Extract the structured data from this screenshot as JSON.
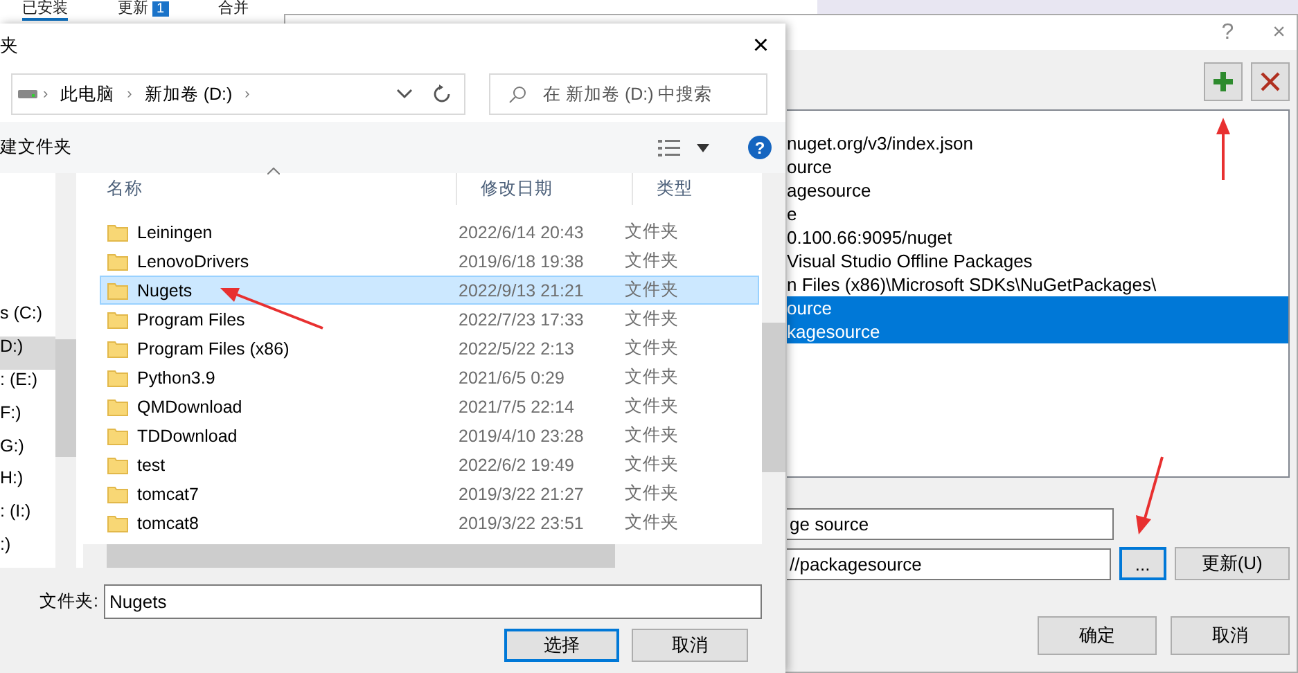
{
  "background_app": {
    "tabs": [
      {
        "label": "已安装",
        "selected": true
      },
      {
        "label": "更新",
        "selected": false,
        "badge": "1"
      },
      {
        "label": "合并",
        "selected": false
      }
    ]
  },
  "options_window": {
    "help": "?",
    "close": "×",
    "sources": [
      {
        "text": "nuget.org/v3/index.json",
        "selected": false
      },
      {
        "text": "ource",
        "selected": false
      },
      {
        "text": "agesource",
        "selected": false
      },
      {
        "text": "e",
        "selected": false
      },
      {
        "text": "0.100.66:9095/nuget",
        "selected": false
      },
      {
        "text": "Visual Studio Offline Packages",
        "selected": false
      },
      {
        "text": "n Files (x86)\\Microsoft SDKs\\NuGetPackages\\",
        "selected": false
      },
      {
        "text": "ource",
        "selected": true
      },
      {
        "text": "kagesource",
        "selected": true
      }
    ],
    "name_field": {
      "value": "ge source"
    },
    "source_field": {
      "value": "//packagesource"
    },
    "browse_button": "...",
    "update_button": "更新(U)",
    "ok_button": "确定",
    "cancel_button": "取消"
  },
  "file_dialog": {
    "title": "夹",
    "close": "×",
    "breadcrumbs": [
      "此电脑",
      "新加卷 (D:)"
    ],
    "separator": "›",
    "search": {
      "placeholder": "在 新加卷 (D:) 中搜索"
    },
    "new_folder": "建文件夹",
    "help": "?",
    "nav": [
      {
        "label": "s (C:)",
        "selected": false
      },
      {
        "label": "D:)",
        "selected": true
      },
      {
        "label": ": (E:)",
        "selected": false
      },
      {
        "label": "F:)",
        "selected": false
      },
      {
        "label": "G:)",
        "selected": false
      },
      {
        "label": "H:)",
        "selected": false
      },
      {
        "label": ": (I:)",
        "selected": false
      },
      {
        "label": ":)",
        "selected": false
      }
    ],
    "columns": [
      "名称",
      "修改日期",
      "类型"
    ],
    "rows": [
      {
        "name": "Leiningen",
        "date": "2022/6/14 20:43",
        "type": "文件夹",
        "selected": false
      },
      {
        "name": "LenovoDrivers",
        "date": "2019/6/18 19:38",
        "type": "文件夹",
        "selected": false
      },
      {
        "name": "Nugets",
        "date": "2022/9/13 21:21",
        "type": "文件夹",
        "selected": true
      },
      {
        "name": "Program Files",
        "date": "2022/7/23 17:33",
        "type": "文件夹",
        "selected": false
      },
      {
        "name": "Program Files (x86)",
        "date": "2022/5/22 2:13",
        "type": "文件夹",
        "selected": false
      },
      {
        "name": "Python3.9",
        "date": "2021/6/5 0:29",
        "type": "文件夹",
        "selected": false
      },
      {
        "name": "QMDownload",
        "date": "2021/7/5 22:14",
        "type": "文件夹",
        "selected": false
      },
      {
        "name": "TDDownload",
        "date": "2019/4/10 23:28",
        "type": "文件夹",
        "selected": false
      },
      {
        "name": "test",
        "date": "2022/6/2 19:49",
        "type": "文件夹",
        "selected": false
      },
      {
        "name": "tomcat7",
        "date": "2019/3/22 21:27",
        "type": "文件夹",
        "selected": false
      },
      {
        "name": "tomcat8",
        "date": "2019/3/22 23:51",
        "type": "文件夹",
        "selected": false
      }
    ],
    "folder_label": "文件夹:",
    "folder_value": "Nugets",
    "select_button": "选择",
    "cancel_button": "取消"
  }
}
